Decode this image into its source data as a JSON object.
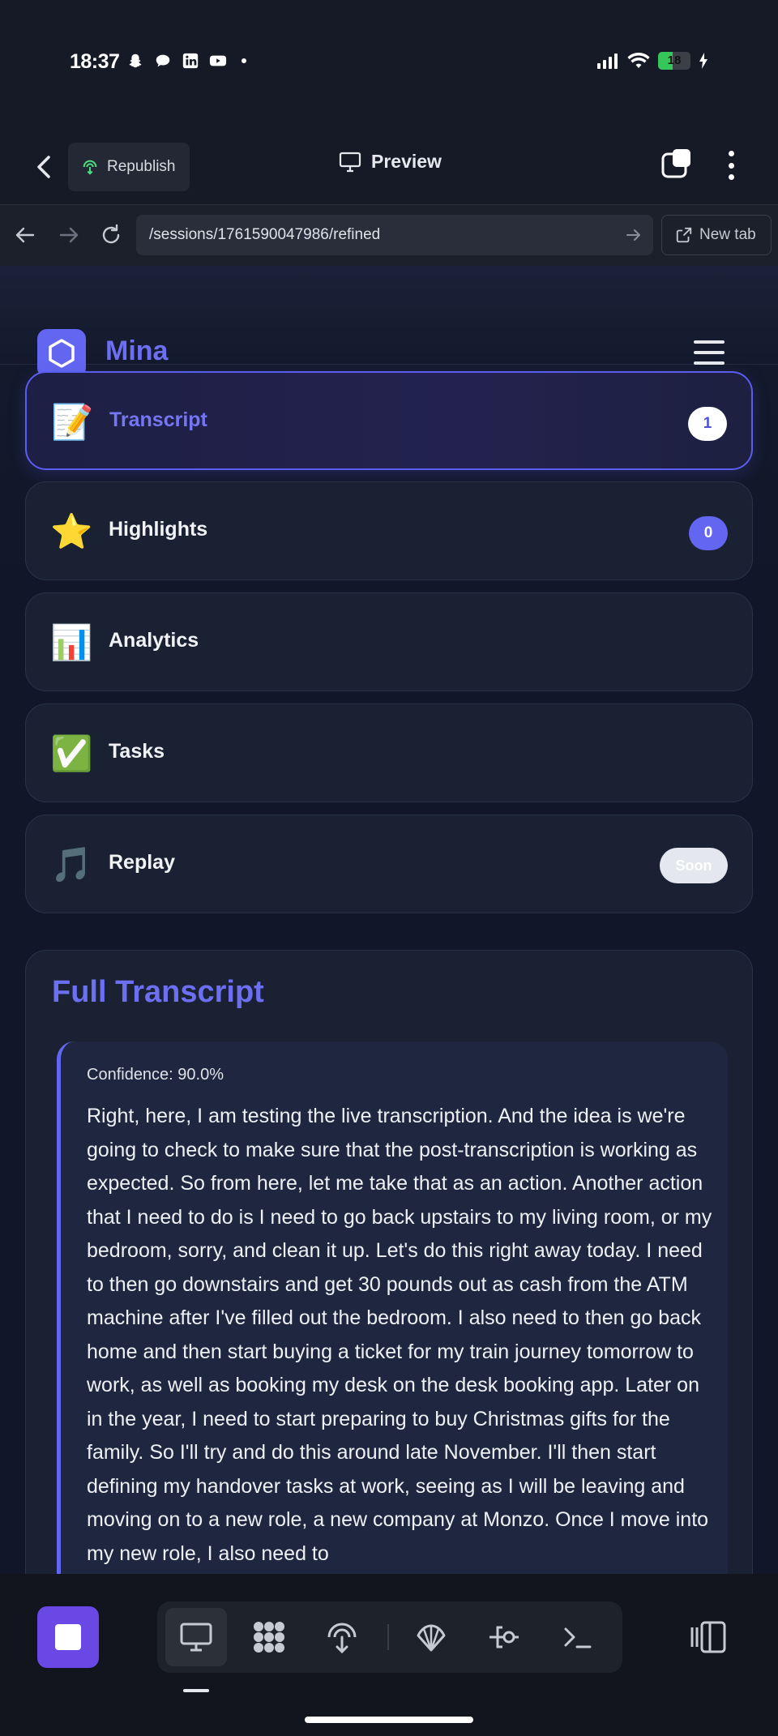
{
  "status_bar": {
    "time": "18:37",
    "notification_icons": [
      "snapchat-icon",
      "chat-icon",
      "linkedin-icon",
      "youtube-icon"
    ],
    "battery_level": "18"
  },
  "browser": {
    "republish_label": "Republish",
    "preview_label": "Preview",
    "url": "/sessions/1761590047986/refined",
    "new_tab_label": "New tab"
  },
  "app": {
    "name": "Mina",
    "accent_color": "#6366f1"
  },
  "nav": [
    {
      "emoji": "📝",
      "label": "Transcript",
      "badge": "1",
      "active": true
    },
    {
      "emoji": "⭐",
      "label": "Highlights",
      "badge": "0",
      "active": false
    },
    {
      "emoji": "📊",
      "label": "Analytics",
      "badge": null,
      "active": false
    },
    {
      "emoji": "✅",
      "label": "Tasks",
      "badge": null,
      "active": false
    },
    {
      "emoji": "🎵",
      "label": "Replay",
      "badge": "Soon",
      "active": false
    }
  ],
  "transcript": {
    "title": "Full Transcript",
    "segments": [
      {
        "confidence": "Confidence: 90.0%",
        "text": "Right, here, I am testing the live transcription. And the idea is we're going to check to make sure that the post-transcription is working as expected. So from here, let me take that as an action. Another action that I need to do is I need to go back upstairs to my living room, or my bedroom, sorry, and clean it up. Let's do this right away today. I need to then go downstairs and get 30 pounds out as cash from the ATM machine after I've filled out the bedroom. I also need to then go back home and then start buying a ticket for my train journey tomorrow to work, as well as booking my desk on the desk booking app. Later on in the year, I need to start preparing to buy Christmas gifts for the family. So I'll try and do this around late November. I'll then start defining my handover tasks at work, seeing as I will be leaving and moving on to a new role, a new company at Monzo. Once I move into my new role, I also need to"
      }
    ]
  },
  "toolbar": {
    "tools": [
      "desktop-icon",
      "apps-icon",
      "deploy-icon",
      "shell-icon",
      "flow-icon",
      "terminal-icon"
    ],
    "active_tool": "desktop-icon"
  }
}
